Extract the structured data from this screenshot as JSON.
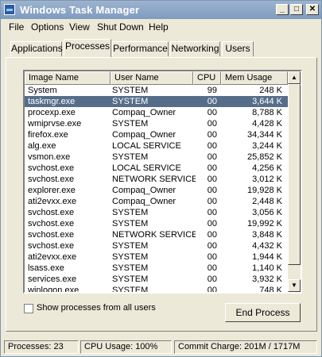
{
  "window": {
    "title": "Windows Task Manager"
  },
  "menu": {
    "items": [
      "File",
      "Options",
      "View",
      "Shut Down",
      "Help"
    ]
  },
  "tabs": [
    "Applications",
    "Processes",
    "Performance",
    "Networking",
    "Users"
  ],
  "active_tab": "Processes",
  "table": {
    "columns": [
      "Image Name",
      "User Name",
      "CPU",
      "Mem Usage"
    ],
    "rows": [
      [
        "System",
        "SYSTEM",
        "99",
        "248 K"
      ],
      [
        "taskmgr.exe",
        "SYSTEM",
        "00",
        "3,644 K"
      ],
      [
        "procexp.exe",
        "Compaq_Owner",
        "00",
        "8,788 K"
      ],
      [
        "wmiprvse.exe",
        "SYSTEM",
        "00",
        "4,428 K"
      ],
      [
        "firefox.exe",
        "Compaq_Owner",
        "00",
        "34,344 K"
      ],
      [
        "alg.exe",
        "LOCAL SERVICE",
        "00",
        "3,244 K"
      ],
      [
        "vsmon.exe",
        "SYSTEM",
        "00",
        "25,852 K"
      ],
      [
        "svchost.exe",
        "LOCAL SERVICE",
        "00",
        "4,256 K"
      ],
      [
        "svchost.exe",
        "NETWORK SERVICE",
        "00",
        "3,012 K"
      ],
      [
        "explorer.exe",
        "Compaq_Owner",
        "00",
        "19,928 K"
      ],
      [
        "ati2evxx.exe",
        "Compaq_Owner",
        "00",
        "2,448 K"
      ],
      [
        "svchost.exe",
        "SYSTEM",
        "00",
        "3,056 K"
      ],
      [
        "svchost.exe",
        "SYSTEM",
        "00",
        "19,992 K"
      ],
      [
        "svchost.exe",
        "NETWORK SERVICE",
        "00",
        "3,848 K"
      ],
      [
        "svchost.exe",
        "SYSTEM",
        "00",
        "4,432 K"
      ],
      [
        "ati2evxx.exe",
        "SYSTEM",
        "00",
        "1,944 K"
      ],
      [
        "lsass.exe",
        "SYSTEM",
        "00",
        "1,140 K"
      ],
      [
        "services.exe",
        "SYSTEM",
        "00",
        "3,932 K"
      ],
      [
        "winlogon.exe",
        "SYSTEM",
        "00",
        "748 K"
      ]
    ],
    "selected_row": 1
  },
  "options": {
    "show_all_label": "Show processes from all users",
    "show_all_checked": false
  },
  "buttons": {
    "end_process": "End Process"
  },
  "status": {
    "processes": "Processes: 23",
    "cpu": "CPU Usage: 100%",
    "commit": "Commit Charge: 201M / 1717M"
  },
  "colors": {
    "title_bar": "#8aa5c7",
    "selection": "#566d8a",
    "face": "#ece9d8"
  }
}
